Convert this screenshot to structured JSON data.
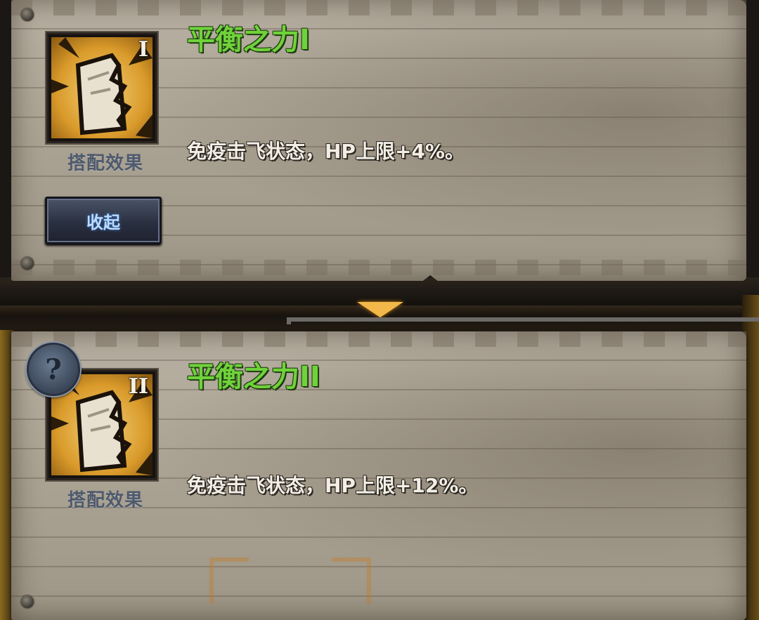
{
  "tier1": {
    "numeral": "I",
    "caption": "搭配效果",
    "title": "平衡之力I",
    "description": "免疫击飞状态，HP上限+4%。",
    "collapse_label": "收起"
  },
  "tier2": {
    "numeral": "II",
    "caption": "搭配效果",
    "title": "平衡之力II",
    "description": "免疫击飞状态，HP上限+12%。",
    "help_symbol": "?"
  },
  "colors": {
    "title_green": "#6fd23a",
    "button_text": "#b9dcff",
    "arrow_orange": "#f3b84a"
  },
  "icons": [
    "fist-icon",
    "help-icon",
    "down-arrow-icon"
  ]
}
